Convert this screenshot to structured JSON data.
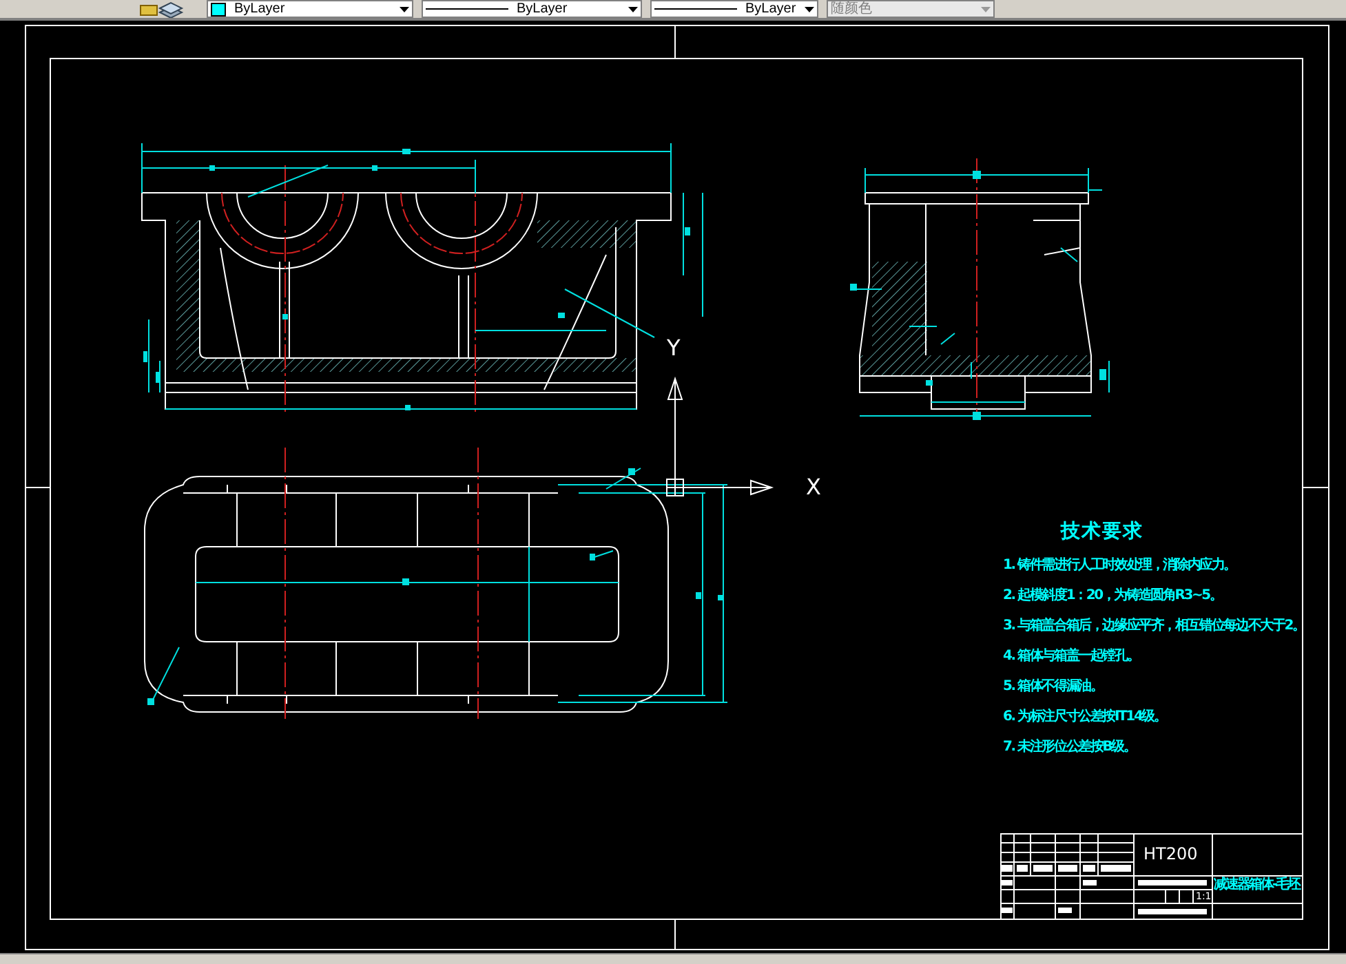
{
  "toolbar": {
    "combos": [
      {
        "kind": "color",
        "value": "ByLayer",
        "disabled": false
      },
      {
        "kind": "linetype",
        "value": "ByLayer",
        "disabled": false
      },
      {
        "kind": "lineweight",
        "value": "ByLayer",
        "disabled": false
      },
      {
        "kind": "plotstyle",
        "value": "随颜色",
        "disabled": true
      }
    ]
  },
  "drawing": {
    "ucs": {
      "x_label": "X",
      "y_label": "Y"
    },
    "technical_requirements": {
      "title": "技术要求",
      "items": [
        "1. 铸件需进行人工时效处理，消除内应力。",
        "2. 起模斜度1：20，为铸造圆角R3~5。",
        "3. 与箱盖合箱后，边缘应平齐，相互错位每边不大于2。",
        "4. 箱体与箱盖一起镗孔。",
        "5. 箱体不得漏油。",
        "6. 为标注尺寸公差按IT14级。",
        "7. 未注形位公差按B级。"
      ]
    },
    "title_block": {
      "material": "HT200",
      "part_name": "减速器箱体-毛坯",
      "scale": "1:1"
    }
  }
}
